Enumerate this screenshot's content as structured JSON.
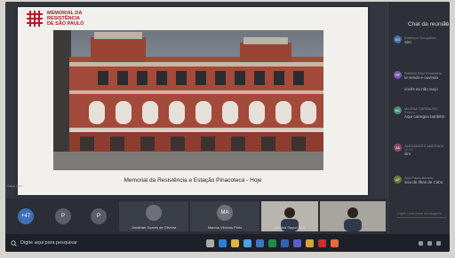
{
  "slide": {
    "logo_line1": "MEMORIAL DA",
    "logo_line2": "RESISTÊNCIA",
    "logo_line3": "DE SÃO PAULO",
    "caption": "Memorial da Resistência e Estação Pinacoteca - Hoje"
  },
  "chat": {
    "title": "Chat da reunião",
    "close_icon": "close-icon",
    "messages": [
      {
        "initials": "EG",
        "author": "Emerson Gonçalves",
        "time": "",
        "text": "Sim",
        "color": "#4a6fa5"
      },
      {
        "initials": "RP",
        "author": "Rafaela Ruiz Florentino",
        "time": "",
        "text": "te vendo e ouvindo",
        "color": "#7a5ea8"
      },
      {
        "initials": "",
        "author": "",
        "time": "",
        "text": "vocês eu não ouço",
        "color": ""
      },
      {
        "initials": "MC",
        "author": "MILENA CARVALHO",
        "time": "Externo",
        "text": "Aqui carregou também",
        "color": "#4c8c6f"
      },
      {
        "initials": "AA",
        "author": "ALEXANDRE ANDRADE",
        "time": "19:13",
        "text": "sim",
        "color": "#8a4f6a"
      },
      {
        "initials": "AP",
        "author": "Ana Paula Barreto",
        "time": "",
        "text": "Sou de Ilhas de Cabo",
        "color": "#6b7a3f"
      }
    ],
    "input_placeholder": "Digite uma nova mensagem"
  },
  "participants": [
    {
      "initials": "+47",
      "name": "",
      "color": "#3f6fb5"
    },
    {
      "initials": "P",
      "name": "",
      "color": "#5a5e66"
    },
    {
      "initials": "P",
      "name": "",
      "color": "#5a5e66"
    },
    {
      "initials": "",
      "name": "Jonathan Soares de Oliveira",
      "color": "#6e7278"
    },
    {
      "initials": "MA",
      "name": "Marcus Vinícius Pinto",
      "color": "#6e7278"
    },
    {
      "initials": "",
      "name": "Jessica Sayuri Hori",
      "color": "#b8b4ae"
    },
    {
      "initials": "",
      "name": "",
      "color": "#a8a49e"
    }
  ],
  "side_label": "Sayu Hori",
  "taskbar": {
    "search_placeholder": "Digite aqui para pesquisar",
    "icons": [
      "search-icon",
      "task-view-icon",
      "edge-icon",
      "explorer-icon",
      "store-icon",
      "mail-icon",
      "excel-icon",
      "word-icon",
      "teams-icon",
      "chrome-icon",
      "acrobat-icon",
      "paint-icon"
    ],
    "icon_colors": [
      "#888",
      "#aaa",
      "#2b7fd4",
      "#e0b341",
      "#4aa0e6",
      "#3a78c4",
      "#1f8a4c",
      "#2f62b3",
      "#5b5fc7",
      "#d9a23a",
      "#c9302c",
      "#e86a3c"
    ]
  }
}
